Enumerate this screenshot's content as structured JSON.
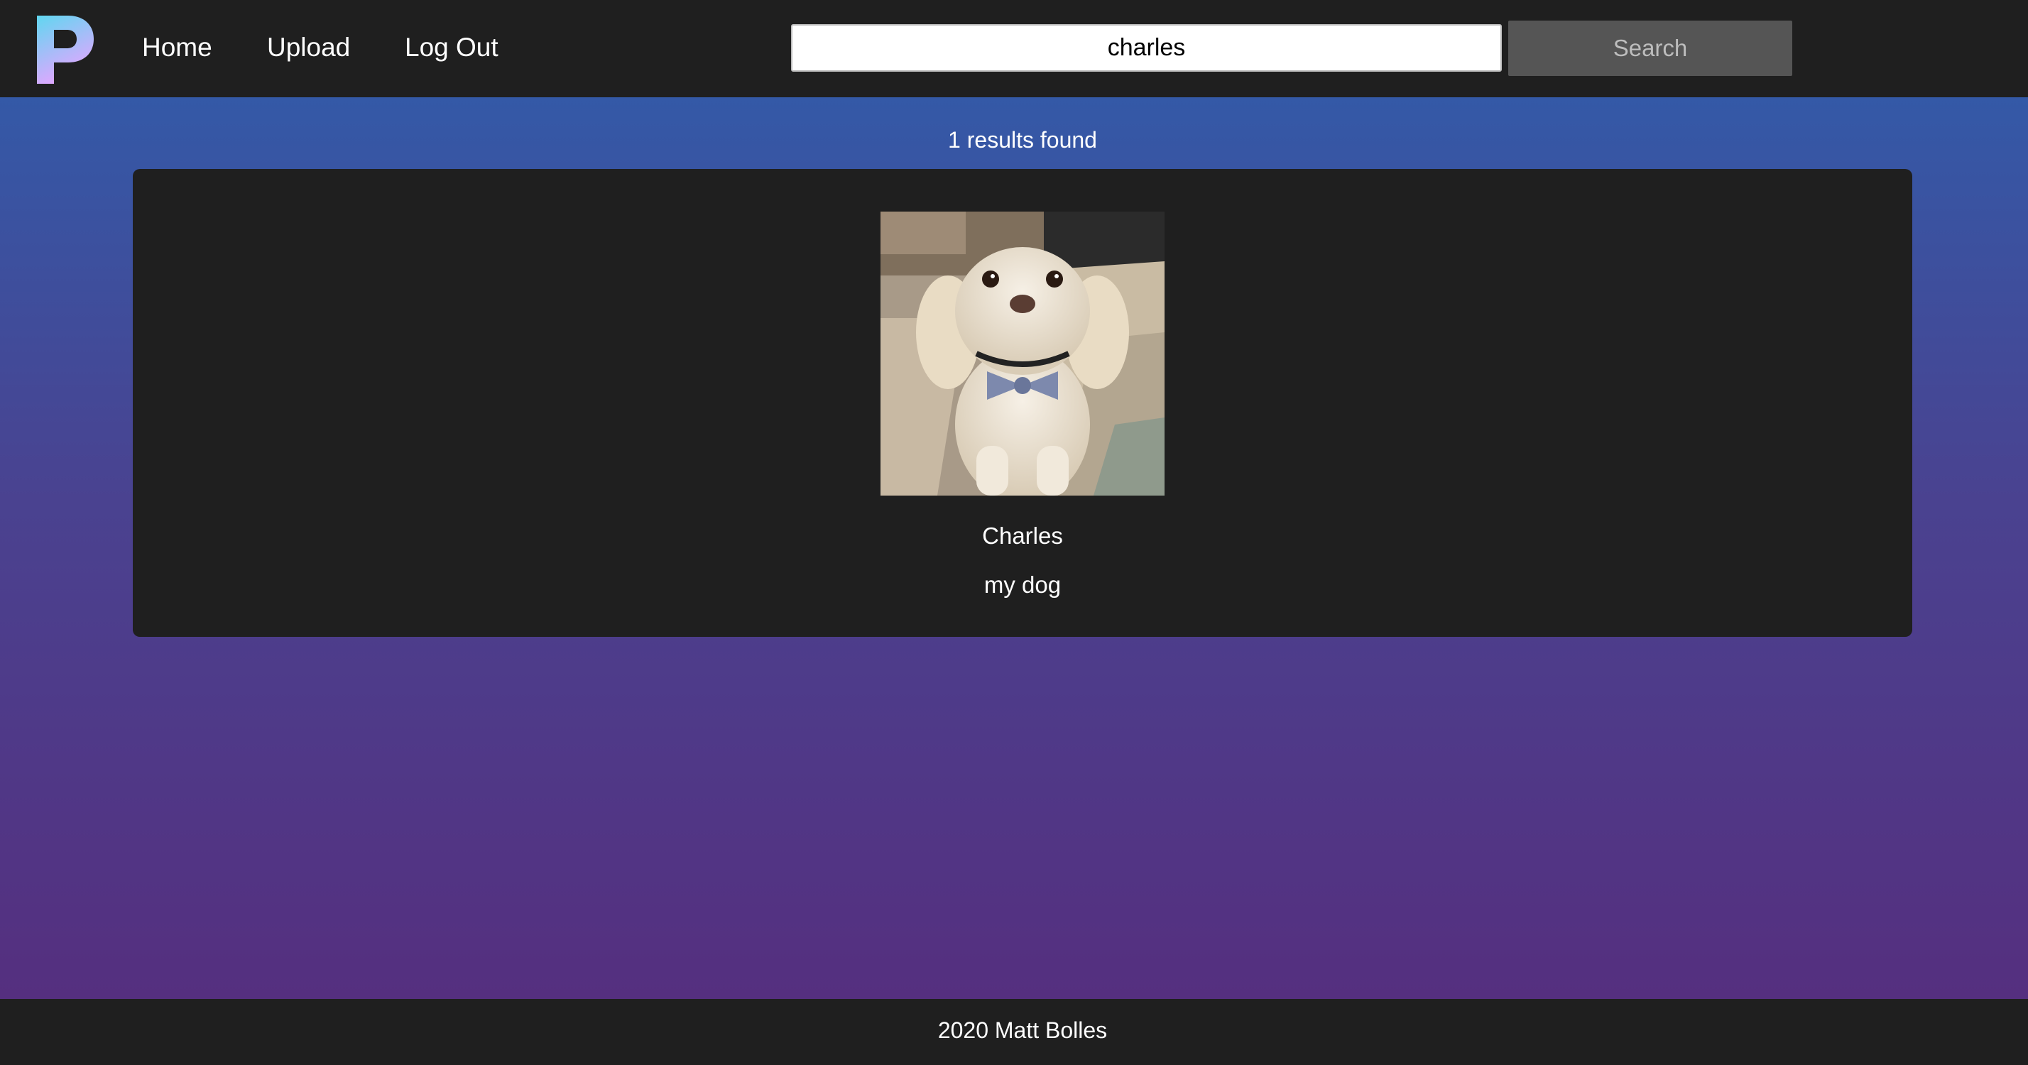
{
  "header": {
    "logo_letter": "P",
    "nav": {
      "home": "Home",
      "upload": "Upload",
      "logout": "Log Out"
    },
    "search": {
      "value": "charles",
      "button_label": "Search"
    }
  },
  "results": {
    "count_text": "1 results found",
    "items": [
      {
        "title": "Charles",
        "description": "my dog"
      }
    ]
  },
  "footer": {
    "text": "2020 Matt Bolles"
  },
  "colors": {
    "bar_background": "#1f1f1f",
    "gradient_top": "#3459a7",
    "gradient_bottom": "#552f7f",
    "search_button": "#555555",
    "logo_gradient": [
      "#5fd7f0",
      "#e3a6ff"
    ]
  }
}
